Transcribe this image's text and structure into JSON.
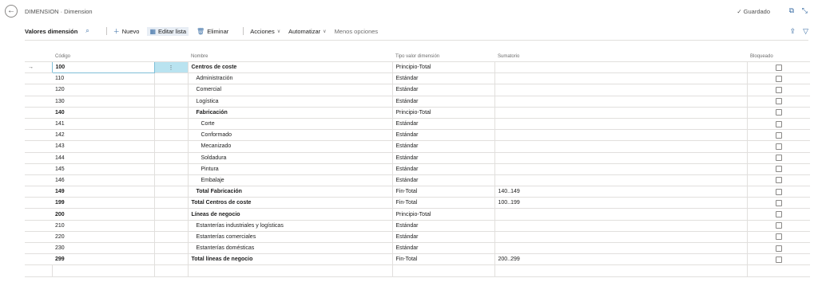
{
  "header": {
    "title": "DIMENSION · Dimension",
    "saved_label": "Guardado"
  },
  "actionbar": {
    "page_name": "Valores dimensión",
    "new_label": "Nuevo",
    "edit_list_label": "Editar lista",
    "delete_label": "Eliminar",
    "actions_label": "Acciones",
    "automate_label": "Automatizar",
    "fewer_options_label": "Menos opciones"
  },
  "columns": {
    "code": "Código",
    "name": "Nombre",
    "type": "Tipo valor dimensión",
    "totaling": "Sumatorio",
    "blocked": "Bloqueado"
  },
  "rows": [
    {
      "code": "100",
      "name": "Centros de coste",
      "type": "Principio-Total",
      "totaling": "",
      "bold": true,
      "indent": 0,
      "selected": true
    },
    {
      "code": "110",
      "name": "Administración",
      "type": "Estándar",
      "totaling": "",
      "bold": false,
      "indent": 1
    },
    {
      "code": "120",
      "name": "Comercial",
      "type": "Estándar",
      "totaling": "",
      "bold": false,
      "indent": 1
    },
    {
      "code": "130",
      "name": "Logística",
      "type": "Estándar",
      "totaling": "",
      "bold": false,
      "indent": 1
    },
    {
      "code": "140",
      "name": "Fabricación",
      "type": "Principio-Total",
      "totaling": "",
      "bold": true,
      "indent": 1
    },
    {
      "code": "141",
      "name": "Corte",
      "type": "Estándar",
      "totaling": "",
      "bold": false,
      "indent": 2
    },
    {
      "code": "142",
      "name": "Conformado",
      "type": "Estándar",
      "totaling": "",
      "bold": false,
      "indent": 2
    },
    {
      "code": "143",
      "name": "Mecanizado",
      "type": "Estándar",
      "totaling": "",
      "bold": false,
      "indent": 2
    },
    {
      "code": "144",
      "name": "Soldadura",
      "type": "Estándar",
      "totaling": "",
      "bold": false,
      "indent": 2
    },
    {
      "code": "145",
      "name": "Pintura",
      "type": "Estándar",
      "totaling": "",
      "bold": false,
      "indent": 2
    },
    {
      "code": "146",
      "name": "Embalaje",
      "type": "Estándar",
      "totaling": "",
      "bold": false,
      "indent": 2
    },
    {
      "code": "149",
      "name": "Total Fabricación",
      "type": "Fin-Total",
      "totaling": "140..149",
      "bold": true,
      "indent": 1
    },
    {
      "code": "199",
      "name": "Total Centros de coste",
      "type": "Fin-Total",
      "totaling": "100..199",
      "bold": true,
      "indent": 0
    },
    {
      "code": "200",
      "name": "Líneas de negocio",
      "type": "Principio-Total",
      "totaling": "",
      "bold": true,
      "indent": 0
    },
    {
      "code": "210",
      "name": "Estanterías industriales y logísticas",
      "type": "Estándar",
      "totaling": "",
      "bold": false,
      "indent": 1
    },
    {
      "code": "220",
      "name": "Estanterías comerciales",
      "type": "Estándar",
      "totaling": "",
      "bold": false,
      "indent": 1
    },
    {
      "code": "230",
      "name": "Estanterías domésticas",
      "type": "Estándar",
      "totaling": "",
      "bold": false,
      "indent": 1
    },
    {
      "code": "299",
      "name": "Total líneas de negocio",
      "type": "Fin-Total",
      "totaling": "200..299",
      "bold": true,
      "indent": 0
    }
  ]
}
